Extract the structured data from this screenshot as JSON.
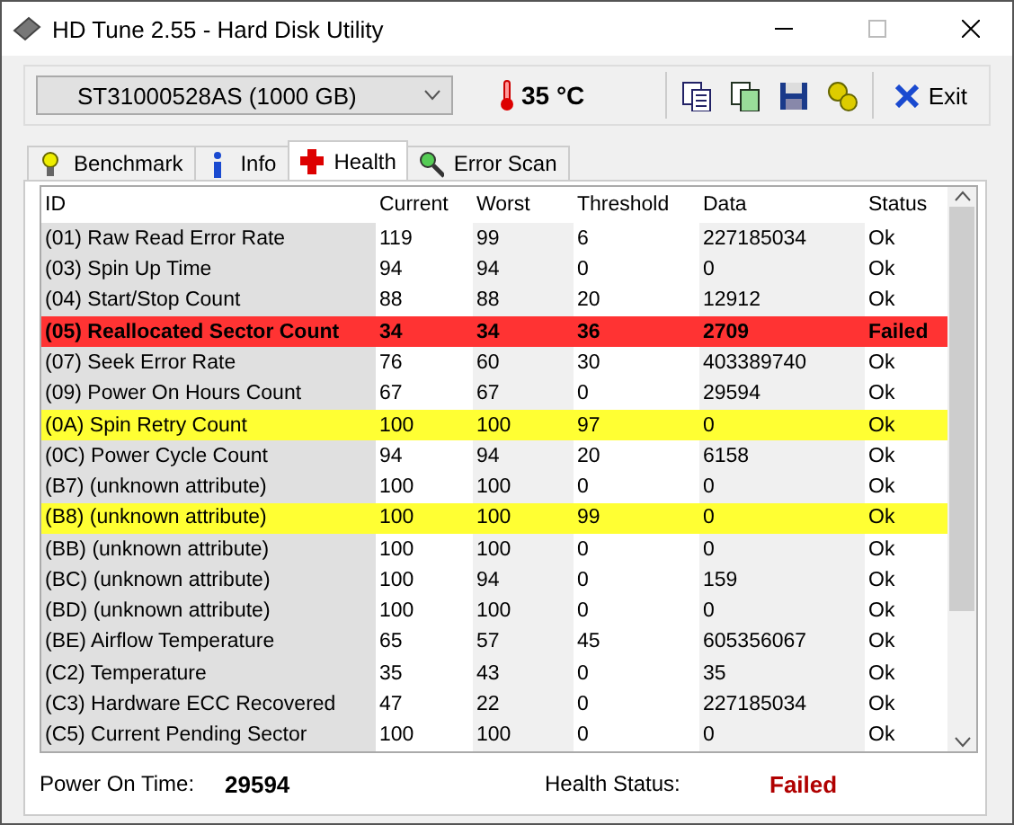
{
  "window": {
    "title": "HD Tune 2.55 - Hard Disk Utility"
  },
  "toolbar": {
    "drive": "ST31000528AS (1000 GB)",
    "temperature": "35 °C",
    "exit": "Exit"
  },
  "tabs": [
    {
      "label": "Benchmark",
      "kind": "bulb",
      "selected": false
    },
    {
      "label": "Info",
      "kind": "info",
      "selected": false
    },
    {
      "label": "Health",
      "kind": "cross",
      "selected": true
    },
    {
      "label": "Error Scan",
      "kind": "magnifier",
      "selected": false
    }
  ],
  "table": {
    "columns": [
      "ID",
      "Current",
      "Worst",
      "Threshold",
      "Data",
      "Status"
    ],
    "rows": [
      {
        "kind": "normal",
        "cells": [
          "(01) Raw Read Error Rate",
          "119",
          "99",
          "6",
          "227185034",
          "Ok"
        ]
      },
      {
        "kind": "normal",
        "cells": [
          "(03) Spin Up Time",
          "94",
          "94",
          "0",
          "0",
          "Ok"
        ]
      },
      {
        "kind": "normal",
        "cells": [
          "(04) Start/Stop Count",
          "88",
          "88",
          "20",
          "12912",
          "Ok"
        ]
      },
      {
        "kind": "failed",
        "cells": [
          "(05) Reallocated Sector Count",
          "34",
          "34",
          "36",
          "2709",
          "Failed"
        ]
      },
      {
        "kind": "normal",
        "cells": [
          "(07) Seek Error Rate",
          "76",
          "60",
          "30",
          "403389740",
          "Ok"
        ]
      },
      {
        "kind": "normal",
        "cells": [
          "(09) Power On Hours Count",
          "67",
          "67",
          "0",
          "29594",
          "Ok"
        ]
      },
      {
        "kind": "warning",
        "cells": [
          "(0A) Spin Retry Count",
          "100",
          "100",
          "97",
          "0",
          "Ok"
        ]
      },
      {
        "kind": "normal",
        "cells": [
          "(0C) Power Cycle Count",
          "94",
          "94",
          "20",
          "6158",
          "Ok"
        ]
      },
      {
        "kind": "normal",
        "cells": [
          "(B7) (unknown attribute)",
          "100",
          "100",
          "0",
          "0",
          "Ok"
        ]
      },
      {
        "kind": "warning",
        "cells": [
          "(B8) (unknown attribute)",
          "100",
          "100",
          "99",
          "0",
          "Ok"
        ]
      },
      {
        "kind": "normal",
        "cells": [
          "(BB) (unknown attribute)",
          "100",
          "100",
          "0",
          "0",
          "Ok"
        ]
      },
      {
        "kind": "normal",
        "cells": [
          "(BC) (unknown attribute)",
          "100",
          "94",
          "0",
          "159",
          "Ok"
        ]
      },
      {
        "kind": "normal",
        "cells": [
          "(BD) (unknown attribute)",
          "100",
          "100",
          "0",
          "0",
          "Ok"
        ]
      },
      {
        "kind": "normal",
        "cells": [
          "(BE) Airflow Temperature",
          "65",
          "57",
          "45",
          "605356067",
          "Ok"
        ]
      },
      {
        "kind": "normal",
        "cells": [
          "(C2) Temperature",
          "35",
          "43",
          "0",
          "35",
          "Ok"
        ]
      },
      {
        "kind": "normal",
        "cells": [
          "(C3) Hardware ECC Recovered",
          "47",
          "22",
          "0",
          "227185034",
          "Ok"
        ]
      },
      {
        "kind": "normal",
        "cells": [
          "(C5) Current Pending Sector",
          "100",
          "100",
          "0",
          "0",
          "Ok"
        ]
      }
    ]
  },
  "status_bar": {
    "power_on_label": "Power On Time:",
    "power_on_value": "29594",
    "health_label": "Health Status:",
    "health_value": "Failed",
    "health_failed": true
  }
}
